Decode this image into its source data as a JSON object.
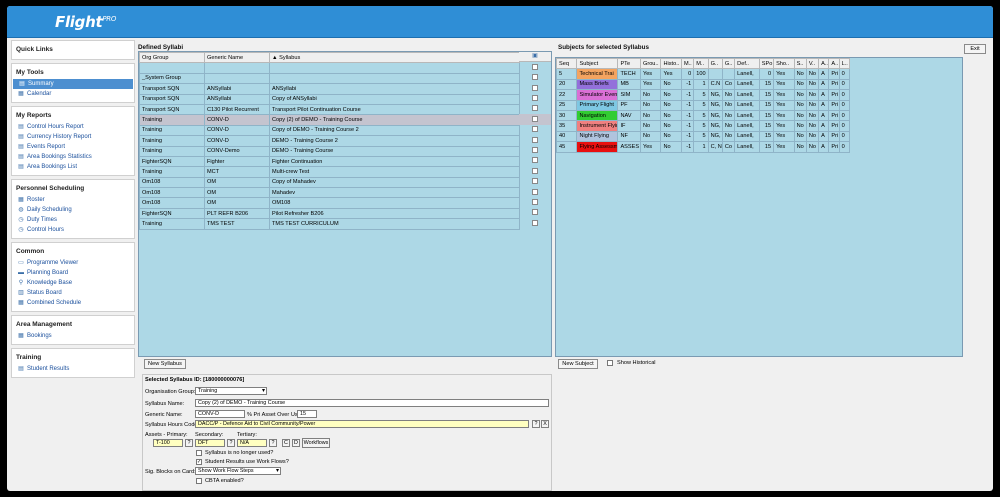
{
  "app": {
    "logo_main": "Flight",
    "logo_sup": "PRO"
  },
  "sidebar": {
    "quick_links": "Quick Links",
    "sections": [
      {
        "title": "My Tools",
        "items": [
          {
            "label": "Summary",
            "icon": "summary-icon",
            "selected": true
          },
          {
            "label": "Calendar",
            "icon": "calendar-icon"
          }
        ]
      },
      {
        "title": "My Reports",
        "items": [
          {
            "label": "Control Hours Report",
            "icon": "report-icon"
          },
          {
            "label": "Currency History Report",
            "icon": "report-icon"
          },
          {
            "label": "Events Report",
            "icon": "report-icon"
          },
          {
            "label": "Area Bookings Statistics",
            "icon": "report-icon"
          },
          {
            "label": "Area Bookings List",
            "icon": "report-icon"
          }
        ]
      },
      {
        "title": "Personnel Scheduling",
        "items": [
          {
            "label": "Roster",
            "icon": "roster-icon"
          },
          {
            "label": "Daily Scheduling",
            "icon": "globe-icon"
          },
          {
            "label": "Duty Times",
            "icon": "clock-icon"
          },
          {
            "label": "Control Hours",
            "icon": "clock-icon"
          }
        ]
      },
      {
        "title": "Common",
        "items": [
          {
            "label": "Programme Viewer",
            "icon": "monitor-icon"
          },
          {
            "label": "Planning Board",
            "icon": "board-icon"
          },
          {
            "label": "Knowledge Base",
            "icon": "search-icon"
          },
          {
            "label": "Status Board",
            "icon": "chart-icon"
          },
          {
            "label": "Combined Schedule",
            "icon": "schedule-icon"
          }
        ]
      },
      {
        "title": "Area Management",
        "items": [
          {
            "label": "Bookings",
            "icon": "bookings-icon"
          }
        ]
      },
      {
        "title": "Training",
        "items": [
          {
            "label": "Student Results",
            "icon": "results-icon"
          }
        ]
      }
    ]
  },
  "syllabi": {
    "title": "Defined Syllabi",
    "columns": [
      "Org Group",
      "Generic Name",
      "Syllabus"
    ],
    "rows": [
      [
        "",
        "",
        ""
      ],
      [
        "_System Group",
        "",
        ""
      ],
      [
        "Transport SQN",
        "ANSyllabi",
        "ANSyllabi"
      ],
      [
        "Transport SQN",
        "ANSyllabi",
        "Copy of ANSyllabi"
      ],
      [
        "Transport SQN",
        "C130 Pilot Recurrent",
        "Transport Pilot Continuation Course"
      ],
      [
        "Training",
        "CONV-D",
        "Copy (2) of DEMO - Training Course"
      ],
      [
        "Training",
        "CONV-D",
        "Copy of DEMO - Training Course 2"
      ],
      [
        "Training",
        "CONV-D",
        "DEMO - Training Course 2"
      ],
      [
        "Training",
        "CONV-Demo",
        "DEMO - Training Course"
      ],
      [
        "FighterSQN",
        "Fighter",
        "Fighter Continuation"
      ],
      [
        "Training",
        "MCT",
        "Multi-crew Test"
      ],
      [
        "Om108",
        "OM",
        "Copy of Mahadev"
      ],
      [
        "Om108",
        "OM",
        "Mahadev"
      ],
      [
        "Om108",
        "OM",
        "OM108"
      ],
      [
        "FighterSQN",
        "PLT REFR B206",
        "Pilot Refresher B206"
      ],
      [
        "Training",
        "TMS TEST",
        "TMS TEST CURRICULUM"
      ]
    ],
    "selected_row": 5,
    "new_button": "New Syllabus"
  },
  "subjects": {
    "title": "Subjects for selected Syllabus",
    "columns": [
      "Seq",
      "Subject",
      "PTe",
      "Grou..",
      "Histo..",
      "M..",
      "M..",
      "G..",
      "G..",
      "Def..",
      "SPo",
      "Sho..",
      "S..",
      "V..",
      "A..",
      "A..",
      "L.."
    ],
    "rows": [
      {
        "cells": [
          "5",
          "Technical Trai",
          "TECH",
          "Yes",
          "Yes",
          "0",
          "100",
          "",
          "",
          "Lanell,",
          "0",
          "Yes",
          "No",
          "No",
          "A",
          "Pri",
          "0"
        ],
        "color": "#f4a460"
      },
      {
        "cells": [
          "20",
          "Mass Briefs",
          "MB",
          "Yes",
          "No",
          "-1",
          "1",
          "C.N",
          "Co",
          "Lanell,",
          "15",
          "Yes",
          "No",
          "No",
          "A",
          "Pri",
          "0"
        ],
        "color": "#9370db"
      },
      {
        "cells": [
          "22",
          "Simulator Even",
          "SIM",
          "No",
          "No",
          "-1",
          "5",
          "NG,",
          "No",
          "Lanell,",
          "15",
          "Yes",
          "No",
          "No",
          "A",
          "Pri",
          "0"
        ],
        "color": "#da70d6"
      },
      {
        "cells": [
          "25",
          "Primary Flight",
          "PF",
          "No",
          "No",
          "-1",
          "5",
          "NG,",
          "No",
          "Lanell,",
          "15",
          "Yes",
          "No",
          "No",
          "A",
          "Pri",
          "0"
        ],
        "color": "#7ec8e3"
      },
      {
        "cells": [
          "30",
          "Navigation",
          "NAV",
          "No",
          "No",
          "-1",
          "5",
          "NG,",
          "No",
          "Lanell,",
          "15",
          "Yes",
          "No",
          "No",
          "A",
          "Pri",
          "0"
        ],
        "color": "#32cd32"
      },
      {
        "cells": [
          "35",
          "Instrument Flyir",
          "IF",
          "No",
          "No",
          "-1",
          "5",
          "NG,",
          "No",
          "Lanell,",
          "15",
          "Yes",
          "No",
          "No",
          "A",
          "Pri",
          "0"
        ],
        "color": "#f08080"
      },
      {
        "cells": [
          "40",
          "Night Flying",
          "NF",
          "No",
          "No",
          "-1",
          "5",
          "NG,",
          "No",
          "Lanell,",
          "15",
          "Yes",
          "No",
          "No",
          "A",
          "Pri",
          "0"
        ],
        "color": "#b0c4de"
      },
      {
        "cells": [
          "45",
          "Flying Assessm",
          "ASSES",
          "Yes",
          "No",
          "-1",
          "1",
          "C, N",
          "Co",
          "Lanell,",
          "15",
          "Yes",
          "No",
          "No",
          "A",
          "Pri",
          "0"
        ],
        "color": "#e81010"
      }
    ],
    "new_button": "New Subject",
    "show_historical": "Show Historical",
    "exit_button": "Exit"
  },
  "form": {
    "title": "Selected Syllabus ID: [180000000076]",
    "org_group_label": "Organisation Group:",
    "org_group_value": "Training",
    "syllabus_name_label": "Syllabus Name:",
    "syllabus_name_value": "Copy (2) of DEMO - Training Course",
    "generic_name_label": "Generic Name:",
    "generic_name_value": "CONV-D",
    "pri_asset_label": "% Pri Asset Over Use:",
    "pri_asset_value": "15",
    "hours_code_label": "Syllabus Hours Code:",
    "hours_code_value": "DACC/P - Defence Aid to Civil Community/Power",
    "hours_code_btn": "?",
    "hours_code_clear": "X",
    "assets_label": "Assets - Primary:",
    "secondary_label": "Secondary:",
    "tertiary_label": "Tertiary:",
    "primary_value": "T-100",
    "secondary_value": "DFT",
    "tertiary_value": "N/A",
    "asset_btn": "?",
    "wf_btn1": "C",
    "wf_btn2": "D",
    "workflows_btn": "Workflows",
    "no_longer_used": "Syllabus is no longer used?",
    "use_work_flows": "Student Results use Work Flows?",
    "sig_blocks_label": "Sig. Blocks on Card:",
    "sig_blocks_value": "Show Work Flow Steps",
    "cbta_enabled": "CBTA enabled?"
  }
}
